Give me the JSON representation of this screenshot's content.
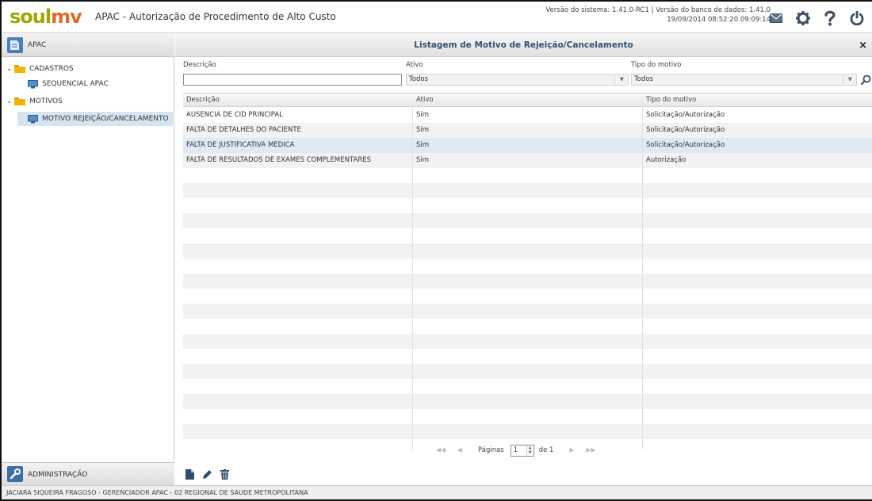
{
  "header": {
    "logo_part1": "soul",
    "logo_part2": "mv",
    "title": "APAC - Autorização de Procedimento de Alto Custo",
    "version_line1": "Versão do sistema: 1.41.0-RC1 | Versão do banco de dados: 1.41.0",
    "version_line2": "19/09/2014 08:52:20   09:09:14",
    "icons": [
      "mail-icon",
      "gear-icon",
      "help-icon",
      "power-icon"
    ]
  },
  "sidebar": {
    "module": "APAC",
    "tree": [
      {
        "label": "CADASTROS",
        "type": "folder",
        "expanded": true
      },
      {
        "label": "SEQUENCIAL APAC",
        "type": "screen"
      },
      {
        "label": "MOTIVOS",
        "type": "folder",
        "expanded": true
      },
      {
        "label": "MOTIVO REJEIÇÃO/CANCELAMENTO",
        "type": "screen",
        "selected": true
      }
    ],
    "bottom_module": "ADMINISTRAÇÃO"
  },
  "panel": {
    "title": "Listagem de Motivo de Rejeição/Cancelamento",
    "close": "×"
  },
  "filters": {
    "descricao_label": "Descrição",
    "descricao_value": "",
    "ativo_label": "Ativo",
    "ativo_value": "Todos",
    "tipo_label": "Tipo do motivo",
    "tipo_value": "Todos"
  },
  "grid": {
    "columns": [
      "Descrição",
      "Ativo",
      "Tipo do motivo"
    ],
    "rows": [
      [
        "AUSENCIA DE CID PRINCIPAL",
        "Sim",
        "Solicitação/Autorização"
      ],
      [
        "FALTA DE DETALHES DO PACIENTE",
        "Sim",
        "Solicitação/Autorização"
      ],
      [
        "FALTA DE JUSTIFICATIVA MEDICA",
        "Sim",
        "Solicitação/Autorização"
      ],
      [
        "FALTA DE RESULTADOS DE EXAMES COMPLEMENTARES",
        "Sim",
        "Autorização"
      ]
    ],
    "selected_row": 2
  },
  "pager": {
    "label": "Páginas",
    "current": "1",
    "of_label": "de 1"
  },
  "actions": [
    "new-icon",
    "edit-icon",
    "delete-icon"
  ],
  "status": {
    "text": "JACIARA SIQUEIRA FRAGOSO - GERENCIADOR APAC - 02 REGIONAL DE SAUDE METROPOLITANA"
  },
  "colors": {
    "logo_green": "#9aa800",
    "logo_orange": "#e06a2c",
    "title_blue": "#344f6e",
    "selected_bg": "#d6e4f1"
  }
}
